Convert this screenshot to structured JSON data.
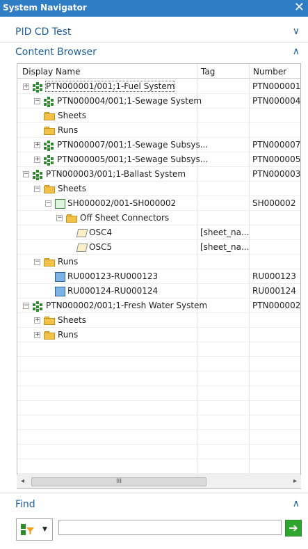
{
  "window": {
    "title": "System Navigator",
    "close_glyph": "✕"
  },
  "sections": {
    "pid": {
      "label": "PID CD Test",
      "chevron": "∨"
    },
    "content": {
      "label": "Content Browser",
      "chevron": "∧"
    },
    "find": {
      "label": "Find",
      "chevron": "∧"
    }
  },
  "table": {
    "columns": [
      "Display Name",
      "Tag",
      "Number"
    ],
    "rows": [
      {
        "name": "PTN000001/001;1-Fuel System",
        "tag": "",
        "number": "PTN000001",
        "icon": "system-icon",
        "expander": "+"
      },
      {
        "name": "PTN000004/001;1-Sewage System",
        "tag": "",
        "number": "PTN000004",
        "icon": "system-icon",
        "expander": "−"
      },
      {
        "name": "Sheets",
        "tag": "",
        "number": "",
        "icon": "folder-icon",
        "expander": ""
      },
      {
        "name": "Runs",
        "tag": "",
        "number": "",
        "icon": "folder-icon",
        "expander": ""
      },
      {
        "name": "PTN000007/001;1-Sewage Subsys...",
        "tag": "",
        "number": "PTN000007",
        "icon": "system-icon",
        "expander": "+"
      },
      {
        "name": "PTN000005/001;1-Sewage Subsys...",
        "tag": "",
        "number": "PTN000005",
        "icon": "system-icon",
        "expander": "+"
      },
      {
        "name": "PTN000003/001;1-Ballast System",
        "tag": "",
        "number": "PTN000003",
        "icon": "system-icon",
        "expander": "−"
      },
      {
        "name": "Sheets",
        "tag": "",
        "number": "",
        "icon": "folder-icon",
        "expander": "−"
      },
      {
        "name": "SH000002/001-SH000002",
        "tag": "",
        "number": "SH000002",
        "icon": "sheet-icon",
        "expander": "−"
      },
      {
        "name": "Off Sheet Connectors",
        "tag": "",
        "number": "",
        "icon": "folder-icon",
        "expander": "−"
      },
      {
        "name": "OSC4",
        "tag": "[sheet_na...",
        "number": "",
        "icon": "connector-icon",
        "expander": ""
      },
      {
        "name": "OSC5",
        "tag": "[sheet_na...",
        "number": "",
        "icon": "connector-icon",
        "expander": ""
      },
      {
        "name": "Runs",
        "tag": "",
        "number": "",
        "icon": "folder-icon",
        "expander": "−"
      },
      {
        "name": "RU000123-RU000123",
        "tag": "",
        "number": "RU000123",
        "icon": "run-icon",
        "expander": ""
      },
      {
        "name": "RU000124-RU000124",
        "tag": "",
        "number": "RU000124",
        "icon": "run-icon",
        "expander": ""
      },
      {
        "name": "PTN000002/001;1-Fresh Water System",
        "tag": "",
        "number": "PTN000002",
        "icon": "system-icon",
        "expander": "−"
      },
      {
        "name": "Sheets",
        "tag": "",
        "number": "",
        "icon": "folder-icon",
        "expander": "+"
      },
      {
        "name": "Runs",
        "tag": "",
        "number": "",
        "icon": "folder-icon",
        "expander": "+"
      }
    ]
  },
  "scrollbar": {
    "left_glyph": "◂",
    "right_glyph": "▸",
    "thumb_glyph": "III"
  },
  "find": {
    "input_value": "",
    "go_glyph": "➔",
    "caret_glyph": "▼"
  },
  "colors": {
    "accent": "#2f7dc5",
    "section_text": "#1f5f9e",
    "go_green": "#2fa52f",
    "folder": "#f3c145",
    "system_green": "#2e8b2e"
  }
}
